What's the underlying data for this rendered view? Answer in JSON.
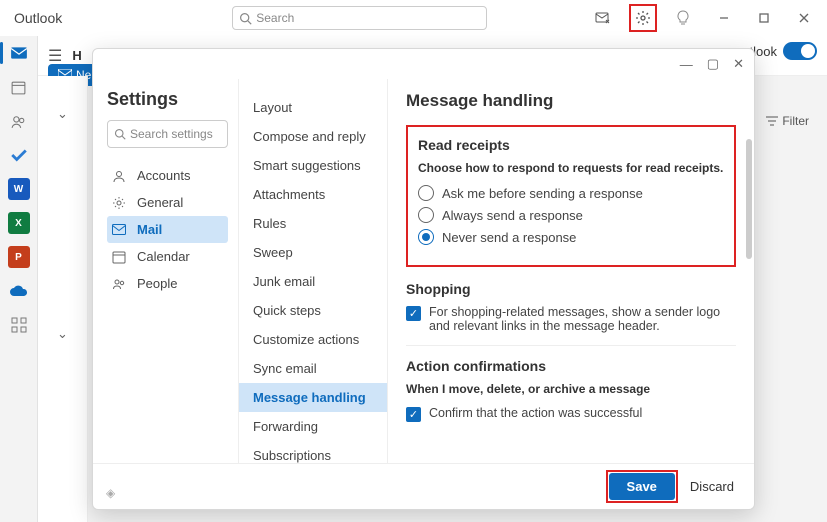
{
  "titlebar": {
    "title": "Outlook",
    "search_placeholder": "Search"
  },
  "bg": {
    "new_label": "Ne",
    "toggle_label": "utlook",
    "filter_label": "Filter"
  },
  "dialog": {
    "title": "Settings",
    "search_placeholder": "Search settings",
    "nav": {
      "accounts": "Accounts",
      "general": "General",
      "mail": "Mail",
      "calendar": "Calendar",
      "people": "People"
    },
    "subnav": {
      "layout": "Layout",
      "compose": "Compose and reply",
      "smart": "Smart suggestions",
      "attachments": "Attachments",
      "rules": "Rules",
      "sweep": "Sweep",
      "junk": "Junk email",
      "quick": "Quick steps",
      "customize": "Customize actions",
      "sync": "Sync email",
      "msghandling": "Message handling",
      "forwarding": "Forwarding",
      "subscriptions": "Subscriptions"
    },
    "content": {
      "heading": "Message handling",
      "read_receipts": {
        "title": "Read receipts",
        "desc": "Choose how to respond to requests for read receipts.",
        "opt_ask": "Ask me before sending a response",
        "opt_always": "Always send a response",
        "opt_never": "Never send a response"
      },
      "shopping": {
        "title": "Shopping",
        "check": "For shopping-related messages, show a sender logo and relevant links in the message header."
      },
      "action": {
        "title": "Action confirmations",
        "desc": "When I move, delete, or archive a message",
        "check": "Confirm that the action was successful"
      }
    },
    "footer": {
      "save": "Save",
      "discard": "Discard"
    }
  }
}
